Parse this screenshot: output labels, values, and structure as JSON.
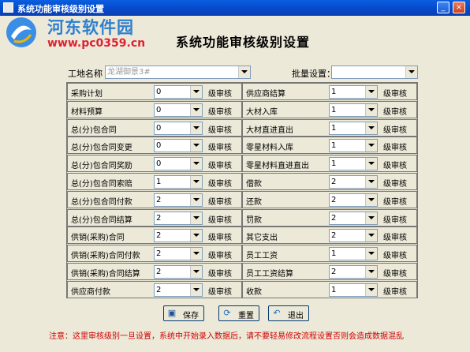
{
  "window": {
    "title": "系统功能审核级别设置",
    "minimize": "_",
    "close": "×"
  },
  "watermark": {
    "name": "河东软件园",
    "url": "www.pc0359.cn"
  },
  "heading": "系统功能审核级别设置",
  "site": {
    "label": "工地名称",
    "value": "龙湖御景3#"
  },
  "batch": {
    "label": "批量设置：",
    "value": ""
  },
  "unit_label": "级审核",
  "left_items": [
    {
      "name": "采购计划",
      "value": "0"
    },
    {
      "name": "材料预算",
      "value": "0"
    },
    {
      "name": "总(分)包合同",
      "value": "0"
    },
    {
      "name": "总(分)包合同变更",
      "value": "0"
    },
    {
      "name": "总(分)包合同奖励",
      "value": "0"
    },
    {
      "name": "总(分)包合同索赔",
      "value": "1"
    },
    {
      "name": "总(分)包合同付款",
      "value": "2"
    },
    {
      "name": "总(分)包合同结算",
      "value": "2"
    },
    {
      "name": "供销(采购)合同",
      "value": "2"
    },
    {
      "name": "供销(采购)合同付款",
      "value": "2"
    },
    {
      "name": "供销(采购)合同结算",
      "value": "2"
    },
    {
      "name": "供应商付款",
      "value": "2"
    }
  ],
  "right_items": [
    {
      "name": "供应商结算",
      "value": "1"
    },
    {
      "name": "大材入库",
      "value": "1"
    },
    {
      "name": "大材直进直出",
      "value": "1"
    },
    {
      "name": "零星材料入库",
      "value": "1"
    },
    {
      "name": "零星材料直进直出",
      "value": "1"
    },
    {
      "name": "借款",
      "value": "2"
    },
    {
      "name": "还款",
      "value": "2"
    },
    {
      "name": "罚款",
      "value": "2"
    },
    {
      "name": "其它支出",
      "value": "2"
    },
    {
      "name": "员工工资",
      "value": "1"
    },
    {
      "name": "员工工资结算",
      "value": "2"
    },
    {
      "name": "收款",
      "value": "1"
    }
  ],
  "buttons": {
    "save": "保存",
    "reset": "重置",
    "exit": "退出"
  },
  "notice": "注意：这里审核级别一旦设置，系统中开始录入数据后，请不要轻易修改流程设置否则会造成数据混乱"
}
